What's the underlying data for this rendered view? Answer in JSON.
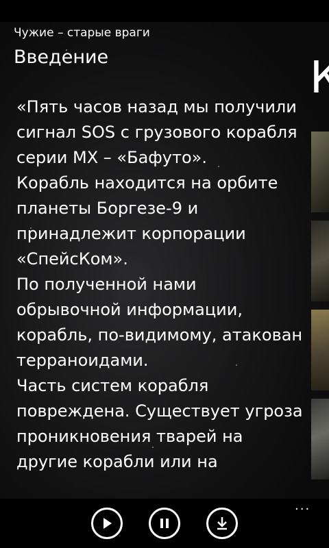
{
  "header": {
    "app_title": "Чужие – старые враги",
    "page_title": "Введение",
    "next_page_peek": "К"
  },
  "story": {
    "paragraphs": [
      "«Пять часов назад мы получили сигнал SOS с грузового корабля серии MX – «Бафуто».",
      "Корабль находится на орбите планеты Боргезе-9 и принадлежит корпорации «СпейсКом».",
      "По полученной нами обрывочной информации, корабль, по-видимому, атакован терраноидами.",
      "Часть систем корабля повреждена. Существует угроза проникновения тварей на другие корабли или на"
    ]
  },
  "app_bar": {
    "more_label": "..."
  },
  "icons": {
    "play": "play-icon",
    "pause": "pause-icon",
    "download": "download-icon"
  },
  "colors": {
    "background": "#000000",
    "text": "#ffffff"
  }
}
